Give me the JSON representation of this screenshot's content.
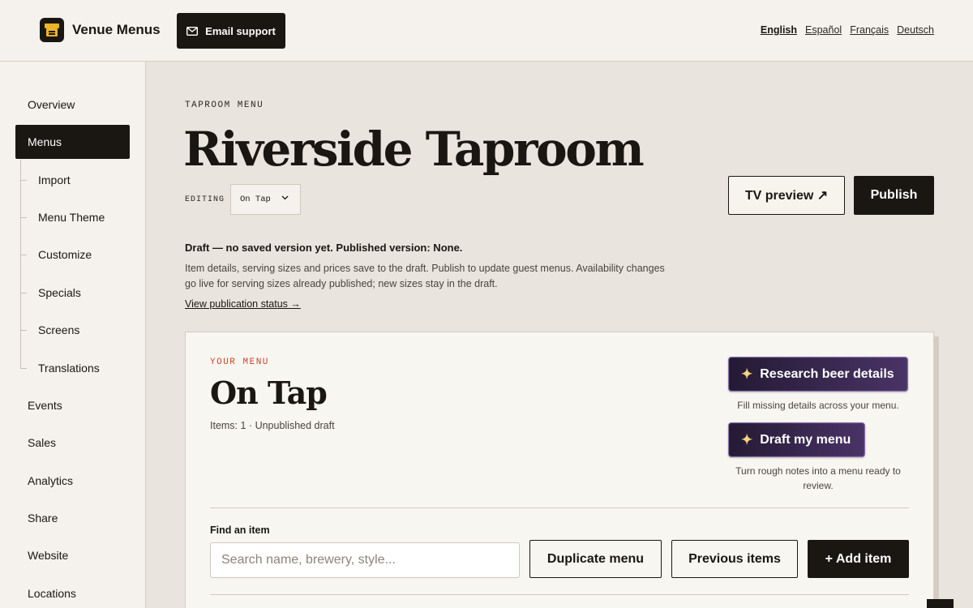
{
  "app": {
    "name": "Venue Menus",
    "logo_icon": "storefront-icon"
  },
  "header": {
    "email_support_label": "Email support",
    "languages": [
      {
        "label": "English",
        "active": true
      },
      {
        "label": "Español",
        "active": false
      },
      {
        "label": "Français",
        "active": false
      },
      {
        "label": "Deutsch",
        "active": false
      }
    ]
  },
  "sidebar": {
    "items": [
      {
        "label": "Overview"
      },
      {
        "label": "Menus",
        "active": true
      },
      {
        "label": "Events"
      },
      {
        "label": "Sales"
      },
      {
        "label": "Analytics"
      },
      {
        "label": "Share"
      },
      {
        "label": "Website"
      },
      {
        "label": "Locations"
      }
    ],
    "subitems": [
      {
        "label": "Import"
      },
      {
        "label": "Menu Theme"
      },
      {
        "label": "Customize"
      },
      {
        "label": "Specials"
      },
      {
        "label": "Screens"
      },
      {
        "label": "Translations"
      }
    ]
  },
  "page": {
    "eyebrow": "TAPROOM MENU",
    "title": "Riverside Taproom",
    "editing_label": "EDITING",
    "editing_value": "On Tap",
    "tv_preview_label": "TV preview ↗",
    "publish_label": "Publish",
    "draft_status": "Draft — no saved version yet. Published version: None.",
    "draft_description": "Item details, serving sizes and prices save to the draft. Publish to update guest menus. Availability changes go live for serving sizes already published; new sizes stay in the draft.",
    "publication_link": "View publication status →"
  },
  "card": {
    "eyebrow": "YOUR MENU",
    "title": "On Tap",
    "meta": "Items: 1 · Unpublished draft",
    "research_label": "Research beer details",
    "research_caption": "Fill missing details across your menu.",
    "draft_menu_label": "Draft my menu",
    "draft_menu_caption": "Turn rough notes into a menu ready to review.",
    "find_label": "Find an item",
    "search_placeholder": "Search name, brewery, style...",
    "duplicate_label": "Duplicate menu",
    "previous_label": "Previous items",
    "add_label": "+ Add item",
    "sparkle_icon": "✦"
  },
  "colors": {
    "ink": "#1a1713",
    "background": "#e9e4dd",
    "panel": "#f5f2ed",
    "accent_red": "#c8442a",
    "ai_purple": "#3a2750",
    "sparkle": "#f6d47c"
  }
}
